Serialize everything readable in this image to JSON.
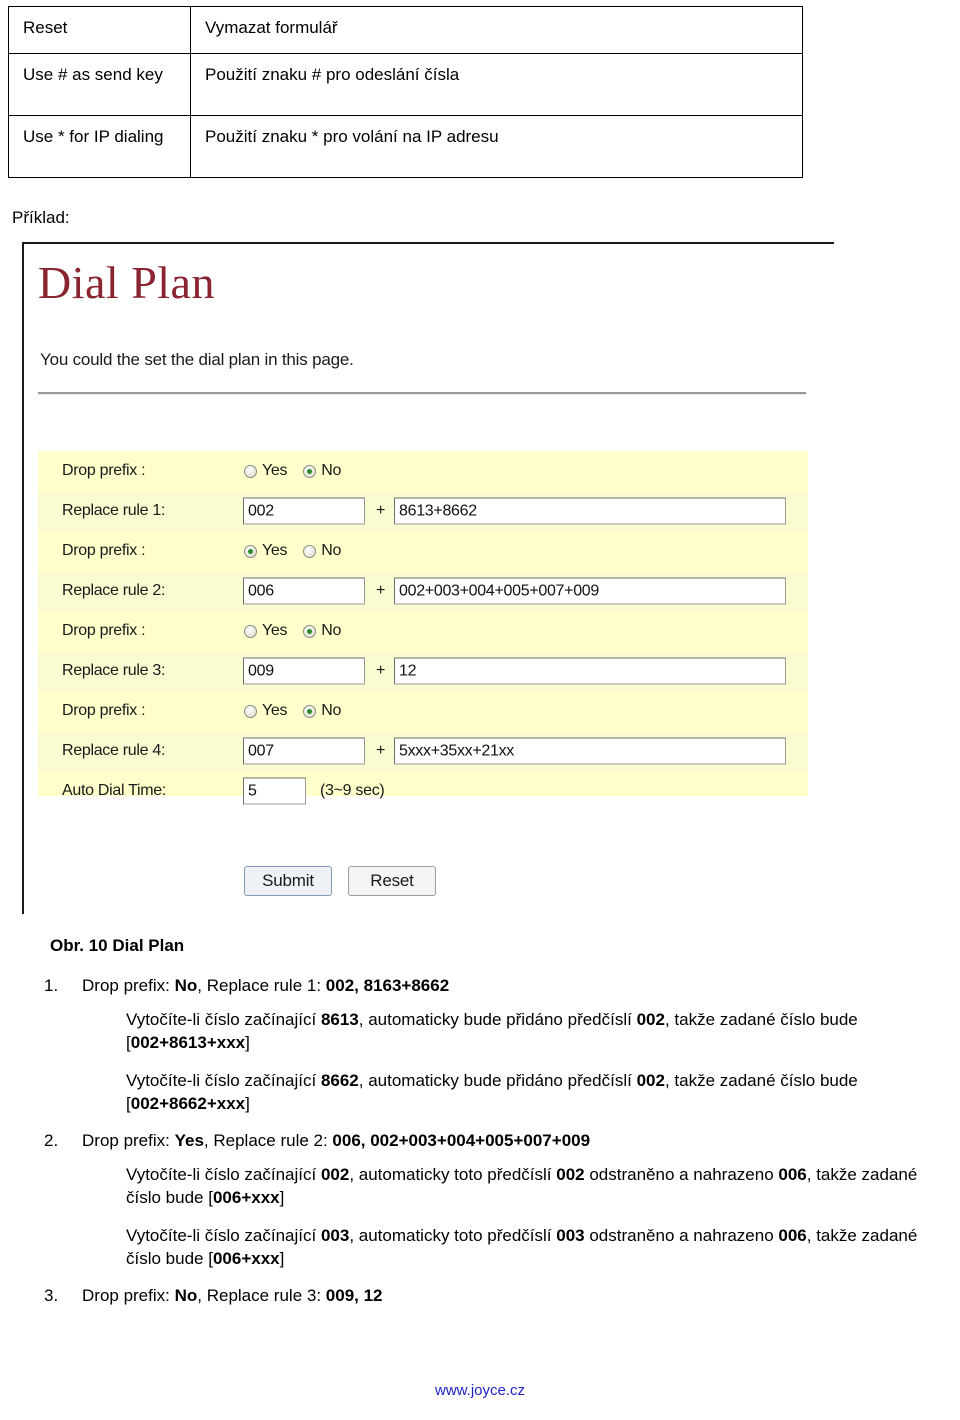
{
  "def_table": {
    "rows": [
      {
        "term": "Reset",
        "desc": "Vymazat formulář"
      },
      {
        "term": "Use # as send key",
        "desc": "Použití znaku # pro odeslání čísla"
      },
      {
        "term": "Use * for IP dialing",
        "desc": "Použití znaku * pro volání na IP adresu"
      }
    ]
  },
  "example_label": "Příklad:",
  "screenshot": {
    "title": "Dial Plan",
    "subtitle": "You could the set the dial plan in this page.",
    "labels": {
      "drop_prefix": "Drop prefix :",
      "auto_dial_time": "Auto Dial Time:",
      "auto_dial_hint": "(3~9 sec)",
      "plus": "+",
      "yes": "Yes",
      "no": "No"
    },
    "rules": [
      {
        "drop_prefix": "No",
        "drop_prefix_yes_selected": false,
        "drop_prefix_no_selected": true,
        "rule_label": "Replace rule 1:",
        "prefix_value": "002",
        "replace_value": "8613+8662"
      },
      {
        "drop_prefix": "Yes",
        "drop_prefix_yes_selected": true,
        "drop_prefix_no_selected": false,
        "rule_label": "Replace rule 2:",
        "prefix_value": "006",
        "replace_value": "002+003+004+005+007+009"
      },
      {
        "drop_prefix": "No",
        "drop_prefix_yes_selected": false,
        "drop_prefix_no_selected": true,
        "rule_label": "Replace rule 3:",
        "prefix_value": "009",
        "replace_value": "12"
      },
      {
        "drop_prefix": "No",
        "drop_prefix_yes_selected": false,
        "drop_prefix_no_selected": true,
        "rule_label": "Replace rule 4:",
        "prefix_value": "007",
        "replace_value": "5xxx+35xx+21xx"
      }
    ],
    "auto_dial_time_value": "5",
    "buttons": {
      "submit": "Submit",
      "reset": "Reset"
    }
  },
  "figure_caption": "Obr. 10 Dial Plan",
  "items": [
    {
      "num": "1.",
      "head_prefix": "Drop prefix: ",
      "head_bold1": "No",
      "head_mid": ", Replace rule 1: ",
      "head_bold2": "002, 8163+8662",
      "paras": [
        {
          "a": "Vytočíte-li číslo začínající  ",
          "b1": "8613",
          "c": ", automaticky bude přidáno předčíslí ",
          "b2": "002",
          "d": ", takže zadané číslo bude [",
          "b3": "002+8613+xxx",
          "e": "]"
        },
        {
          "a": "Vytočíte-li číslo začínající  ",
          "b1": "8662",
          "c": ", automaticky bude přidáno předčíslí ",
          "b2": "002",
          "d": ", takže zadané číslo bude [",
          "b3": "002+8662+xxx",
          "e": "]"
        }
      ]
    },
    {
      "num": "2.",
      "head_prefix": "Drop prefix: ",
      "head_bold1": "Yes",
      "head_mid": ", Replace rule 2: ",
      "head_bold2": "006, 002+003+004+005+007+009",
      "paras": [
        {
          "a": "Vytočíte-li číslo začínající  ",
          "b1": "002",
          "c": ", automaticky toto předčíslí ",
          "b2": "002",
          "d": " odstraněno a nahrazeno ",
          "b3": "006",
          "e": ", takže zadané číslo bude [",
          "b4": "006+xxx",
          "f": "]"
        },
        {
          "a": "Vytočíte-li číslo začínající  ",
          "b1": "003",
          "c": ", automaticky toto předčíslí ",
          "b2": "003",
          "d": " odstraněno a nahrazeno ",
          "b3": "006",
          "e": ", takže zadané číslo bude [",
          "b4": "006+xxx",
          "f": "]"
        }
      ]
    },
    {
      "num": "3.",
      "head_prefix": "Drop prefix: ",
      "head_bold1": "No",
      "head_mid": ", Replace rule 3: ",
      "head_bold2": "009, 12",
      "paras": []
    }
  ],
  "footer": "www.joyce.cz"
}
